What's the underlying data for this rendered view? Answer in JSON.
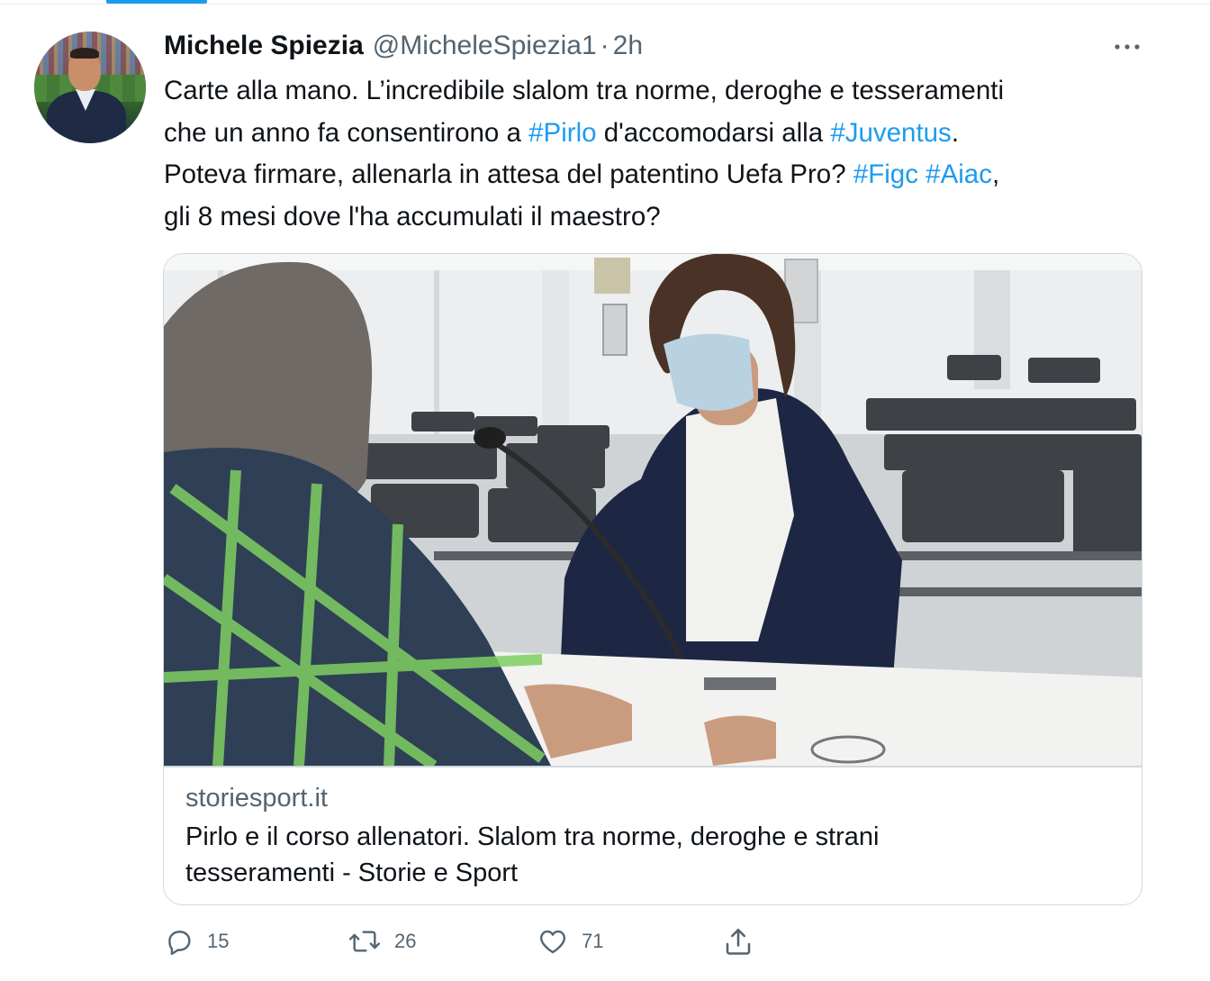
{
  "author": {
    "name": "Michele Spiezia",
    "handle": "@MicheleSpiezia1",
    "separator": "·",
    "time": "2h"
  },
  "tweet": {
    "segments": [
      [
        {
          "text": "Carte alla mano. L’incredibile slalom tra norme, deroghe e tesseramenti",
          "hashtag": false
        }
      ],
      [
        {
          "text": "che un anno fa consentirono a ",
          "hashtag": false
        },
        {
          "text": "#Pirlo",
          "hashtag": true
        },
        {
          "text": " d'accomodarsi alla ",
          "hashtag": false
        },
        {
          "text": "#Juventus",
          "hashtag": true
        },
        {
          "text": ".",
          "hashtag": false
        }
      ],
      [
        {
          "text": "Poteva firmare, allenarla in attesa del patentino Uefa Pro? ",
          "hashtag": false
        },
        {
          "text": "#Figc",
          "hashtag": true
        },
        {
          "text": " ",
          "hashtag": false
        },
        {
          "text": "#Aiac",
          "hashtag": true
        },
        {
          "text": ",",
          "hashtag": false
        }
      ],
      [
        {
          "text": "gli 8 mesi dove l'ha accumulati il maestro?",
          "hashtag": false
        }
      ]
    ]
  },
  "card": {
    "domain": "storiesport.it",
    "title_line1": "Pirlo e il corso allenatori. Slalom tra norme, deroghe e strani",
    "title_line2": "tesseramenti - Storie e Sport"
  },
  "actions": {
    "replies": "15",
    "retweets": "26",
    "likes": "71"
  },
  "icons": {
    "more": "more-horizontal-icon",
    "reply": "reply-icon",
    "retweet": "retweet-icon",
    "like": "heart-icon",
    "share": "share-icon"
  },
  "colors": {
    "accent": "#1d9bf0",
    "secondary_text": "#536471",
    "primary_text": "#0f1419",
    "border": "#cfd9de"
  }
}
